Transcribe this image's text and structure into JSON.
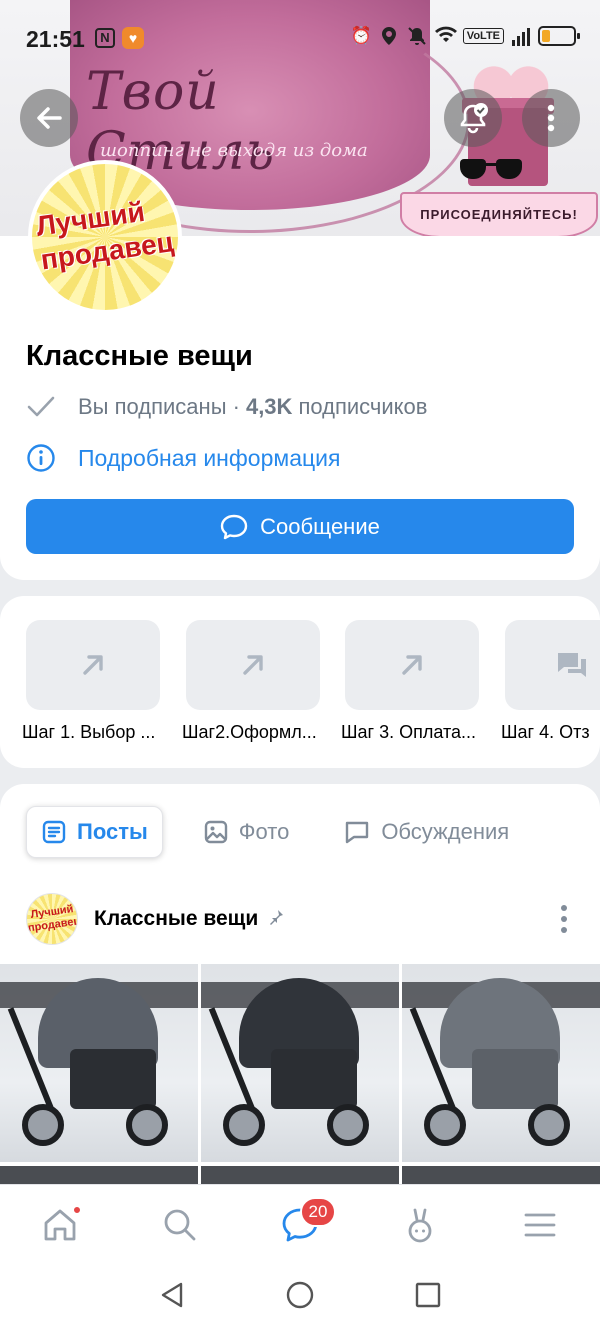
{
  "status_bar": {
    "time": "21:51",
    "nfc_label": "N",
    "app_icon": "bell-notify-icon",
    "volte": "VoLTE",
    "icons": [
      "alarm-icon",
      "location-icon",
      "mute-icon",
      "wifi-icon",
      "signal-icon",
      "battery-icon"
    ]
  },
  "cover": {
    "brand": "Твой Стиль",
    "tagline": "шоппинг не выходя из дома",
    "join_label": "ПРИСОЕДИНЯЙТЕСЬ!"
  },
  "avatar": {
    "text": "Лучший продавец"
  },
  "group": {
    "name": "Классные вещи",
    "subscribed": "Вы подписаны ·",
    "subscribers_count": "4,3K",
    "subscribers_word": "подписчиков",
    "details_link": "Подробная информация",
    "message_button": "Сообщение"
  },
  "steps": [
    {
      "label": "Шаг 1. Выбор ...",
      "icon": "arrow-up-right-icon"
    },
    {
      "label": "Шаг2.Оформл...",
      "icon": "arrow-up-right-icon"
    },
    {
      "label": "Шаг 3. Оплата...",
      "icon": "arrow-up-right-icon"
    },
    {
      "label": "Шаг 4. Отз",
      "icon": "discussion-icon"
    }
  ],
  "tabs": [
    {
      "label": "Посты",
      "icon": "posts-icon",
      "active": true
    },
    {
      "label": "Фото",
      "icon": "photo-icon",
      "active": false
    },
    {
      "label": "Обсуждения",
      "icon": "discussion-icon",
      "active": false
    }
  ],
  "post": {
    "author": "Классные вещи",
    "author_avatar_text": "Лучший продавец",
    "pinned_icon": "pin-icon"
  },
  "bottom_nav": {
    "items": [
      "home-icon",
      "search-icon",
      "messages-icon",
      "clips-icon",
      "menu-icon"
    ],
    "messages_badge": "20"
  },
  "colors": {
    "accent": "#2688eb",
    "badge": "#e64646",
    "secondary_text": "#6d7885",
    "icon_grey": "#818c99",
    "background": "#ebedf0"
  }
}
